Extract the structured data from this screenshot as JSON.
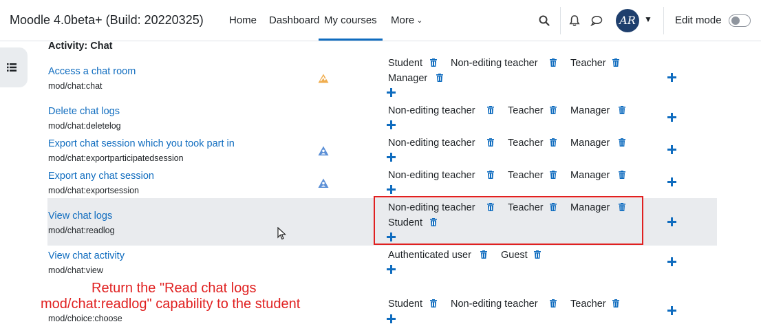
{
  "navbar": {
    "brand": "Moodle 4.0beta+ (Build: 20220325)",
    "links": [
      "Home",
      "Dashboard",
      "My courses",
      "More"
    ],
    "active_link": "My courses",
    "avatar_initials": "AR",
    "edit_mode_label": "Edit mode",
    "edit_mode_on": false
  },
  "section_title": "Activity: Chat",
  "rows": [
    {
      "name": "Access a chat room",
      "code": "mod/chat:chat",
      "risk_icon": "spam-risk-icon",
      "roles": [
        "Student",
        "Non-editing teacher",
        "Teacher",
        "Manager"
      ]
    },
    {
      "name": "Delete chat logs",
      "code": "mod/chat:deletelog",
      "risk_icon": "",
      "roles": [
        "Non-editing teacher",
        "Teacher",
        "Manager"
      ]
    },
    {
      "name": "Export chat session which you took part in",
      "code": "mod/chat:exportparticipatedsession",
      "risk_icon": "personal-risk-icon",
      "roles": [
        "Non-editing teacher",
        "Teacher",
        "Manager"
      ]
    },
    {
      "name": "Export any chat session",
      "code": "mod/chat:exportsession",
      "risk_icon": "personal-risk-icon",
      "roles": [
        "Non-editing teacher",
        "Teacher",
        "Manager"
      ]
    },
    {
      "name": "View chat logs",
      "code": "mod/chat:readlog",
      "risk_icon": "",
      "roles": [
        "Non-editing teacher",
        "Teacher",
        "Manager",
        "Student"
      ]
    },
    {
      "name": "View chat activity",
      "code": "mod/chat:view",
      "risk_icon": "",
      "roles": [
        "Authenticated user",
        "Guest"
      ]
    },
    {
      "name": "",
      "code": "mod/choice:choose",
      "risk_icon": "",
      "roles": [
        "Student",
        "Non-editing teacher",
        "Teacher"
      ]
    }
  ],
  "annotation": {
    "line1": "Return the \"Read chat logs",
    "line2": "mod/chat:readlog\" capability to the student"
  },
  "colors": {
    "link": "#0f6cbf",
    "highlight_box": "#e02020",
    "annotation": "#e02020",
    "row_highlight": "#e9ebee"
  }
}
